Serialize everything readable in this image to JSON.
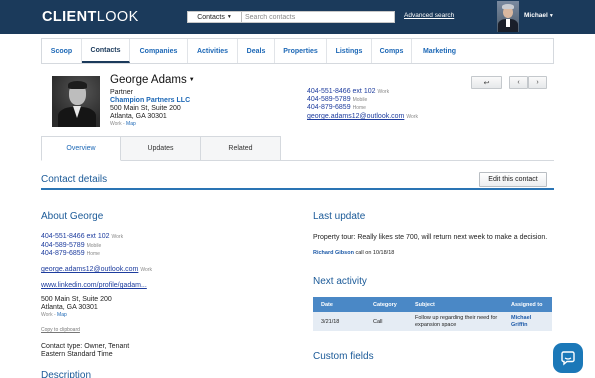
{
  "header": {
    "logo_bold": "CLIENT",
    "logo_light": "LOOK",
    "search_scope": "Contacts",
    "search_placeholder": "Search contacts",
    "advanced_search": "Advanced search",
    "user_name": "Michael"
  },
  "nav": {
    "items": [
      "Scoop",
      "Contacts",
      "Companies",
      "Activities",
      "Deals",
      "Properties",
      "Listings",
      "Comps",
      "Marketing"
    ],
    "active": "Contacts"
  },
  "contact": {
    "name": "George Adams",
    "title": "Partner",
    "company": "Champion Partners LLC",
    "address_line1": "500 Main St, Suite 200",
    "address_line2": "Atlanta, GA 30301",
    "address_tag": "Work",
    "map_link": "Map",
    "phones": [
      {
        "number": "404-551-8466 ext 102",
        "tag": "Work"
      },
      {
        "number": "404-589-5789",
        "tag": "Mobile"
      },
      {
        "number": "404-879-6859",
        "tag": "Home"
      }
    ],
    "email": "george.adams12@outlook.com",
    "email_tag": "Work"
  },
  "tabs": {
    "items": [
      "Overview",
      "Updates",
      "Related"
    ],
    "active": "Overview"
  },
  "contact_details": {
    "title": "Contact details",
    "edit_button": "Edit this contact"
  },
  "about": {
    "title": "About George",
    "phones": [
      {
        "number": "404-551-8466 ext 102",
        "tag": "Work"
      },
      {
        "number": "404-589-5789",
        "tag": "Mobile"
      },
      {
        "number": "404-879-6859",
        "tag": "Home"
      }
    ],
    "email": "george.adams12@outlook.com",
    "email_tag": "Work",
    "linkedin": "www.linkedin.com/profile/gadam...",
    "address_line1": "500 Main St, Suite 200",
    "address_line2": "Atlanta, GA 30301",
    "address_tag": "Work",
    "map_link": "Map",
    "copy_link": "Copy to clipboard",
    "contact_type": "Contact type: Owner, Tenant",
    "timezone": "Eastern Standard Time"
  },
  "description": {
    "title": "Description"
  },
  "last_update": {
    "title": "Last update",
    "text": "Property tour: Really likes ste 700, will return next week to make a decision.",
    "author": "Richard Gibson",
    "meta": " call on 10/18/18"
  },
  "next_activity": {
    "title": "Next activity",
    "columns": [
      "Date",
      "Category",
      "Subject",
      "Assigned to"
    ],
    "rows": [
      {
        "date": "3/21/18",
        "category": "Call",
        "subject": "Follow up regarding their need for expansion space",
        "assigned": "Michael Griffin"
      }
    ]
  },
  "custom_fields": {
    "title": "Custom fields"
  },
  "icons": {
    "back_button": "reply-arrow-icon",
    "prev_button": "chevron-left-icon",
    "next_button": "chevron-right-icon",
    "chat": "chat-bubble-icon"
  },
  "colors": {
    "header_bg": "#1b3a5b",
    "link": "#1d68b6",
    "table_header": "#4a88c6",
    "chat_button": "#1b78b8"
  }
}
